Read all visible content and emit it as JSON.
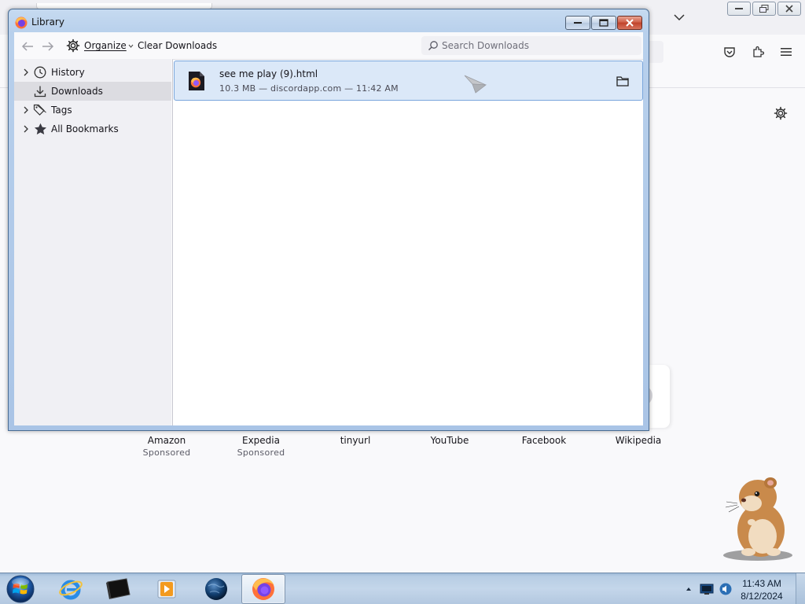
{
  "library": {
    "title": "Library",
    "toolbar": {
      "organize_label": "Organize",
      "clear_downloads_label": "Clear Downloads",
      "search_placeholder": "Search Downloads"
    },
    "places": [
      {
        "label": "History",
        "icon": "clock-icon",
        "expandable": true
      },
      {
        "label": "Downloads",
        "icon": "download-icon",
        "expandable": false,
        "selected": true
      },
      {
        "label": "Tags",
        "icon": "tag-icon",
        "expandable": true
      },
      {
        "label": "All Bookmarks",
        "icon": "star-icon",
        "expandable": true
      }
    ],
    "downloads": [
      {
        "filename": "see me play (9).html",
        "status": "10.3 MB — discordapp.com — 11:42 AM"
      }
    ]
  },
  "firefox": {
    "shortcuts": [
      {
        "title": "Amazon",
        "sponsored": "Sponsored"
      },
      {
        "title": "Expedia",
        "sponsored": "Sponsored"
      },
      {
        "title": "tinyurl",
        "sponsored": ""
      },
      {
        "title": "YouTube",
        "sponsored": ""
      },
      {
        "title": "Facebook",
        "sponsored": ""
      },
      {
        "title": "Wikipedia",
        "sponsored": ""
      }
    ]
  },
  "taskbar": {
    "apps": [
      "internet-explorer",
      "terminal",
      "media-player",
      "globe-app",
      "firefox"
    ],
    "active_app": "firefox",
    "clock_time": "11:43 AM",
    "clock_date": "8/12/2024"
  },
  "colors": {
    "selection_bg": "#dbe8f8",
    "selection_border": "#7aa6dc",
    "window_frame": "#b8d0ec"
  }
}
